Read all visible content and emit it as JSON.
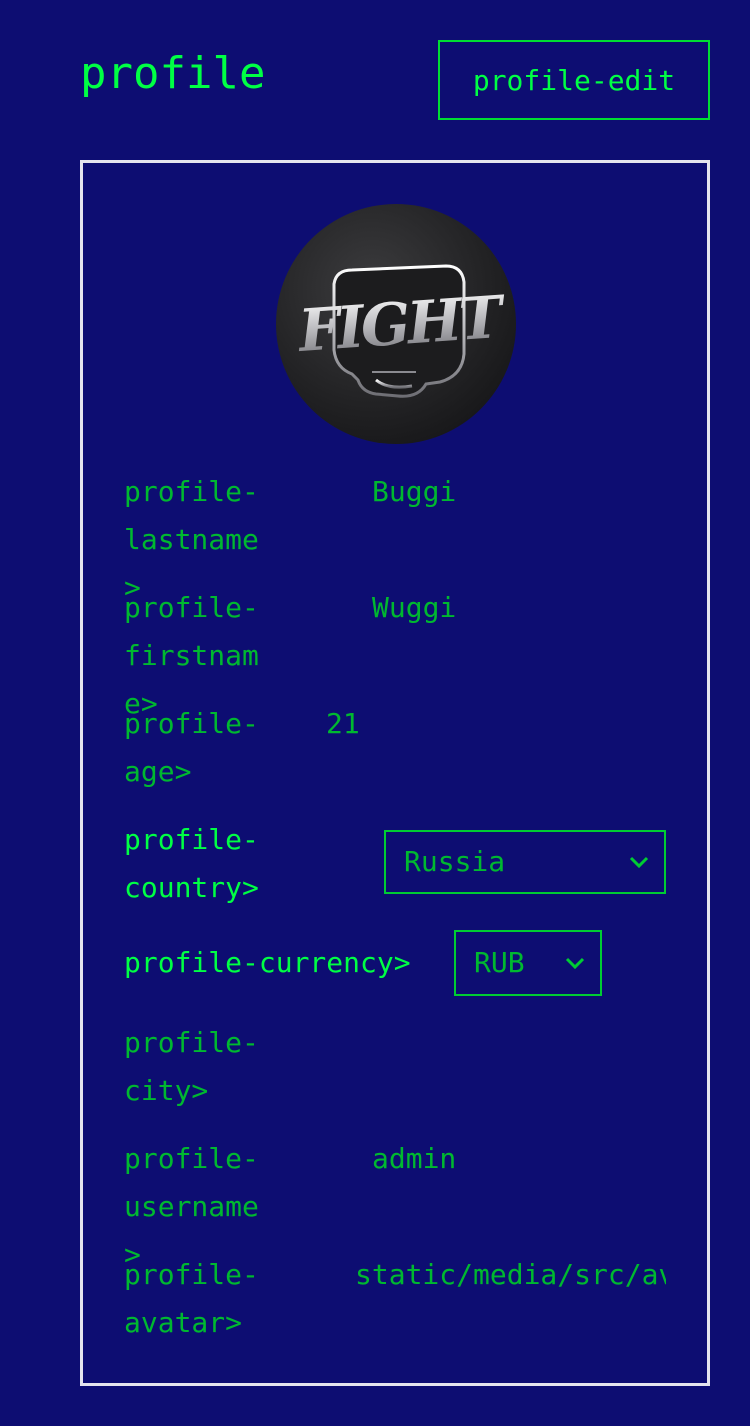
{
  "header": {
    "title": "profile",
    "edit_label": "profile-edit"
  },
  "profile": {
    "lastname": {
      "label": "profile-\nlastname>",
      "value": "Buggi"
    },
    "firstname": {
      "label": "profile-\nfirstname>",
      "value": "Wuggi"
    },
    "age": {
      "label": "profile-\nage>",
      "value": "21"
    },
    "country": {
      "label": "profile-\ncountry>",
      "selected": "Russia"
    },
    "currency": {
      "label": "profile-currency>",
      "selected": "RUB"
    },
    "city": {
      "label": "profile-\ncity>",
      "value": ""
    },
    "username": {
      "label": "profile-\nusername>",
      "value": "admin"
    },
    "avatar": {
      "label": "profile-\navatar>",
      "value": "static/media/src/avatar.jpg"
    }
  },
  "avatar_image": {
    "text": "FIGHT"
  },
  "colors": {
    "background": "#0d0d72",
    "accent": "#00ff44",
    "muted": "#00b830",
    "card_border": "#e4e4ee"
  }
}
